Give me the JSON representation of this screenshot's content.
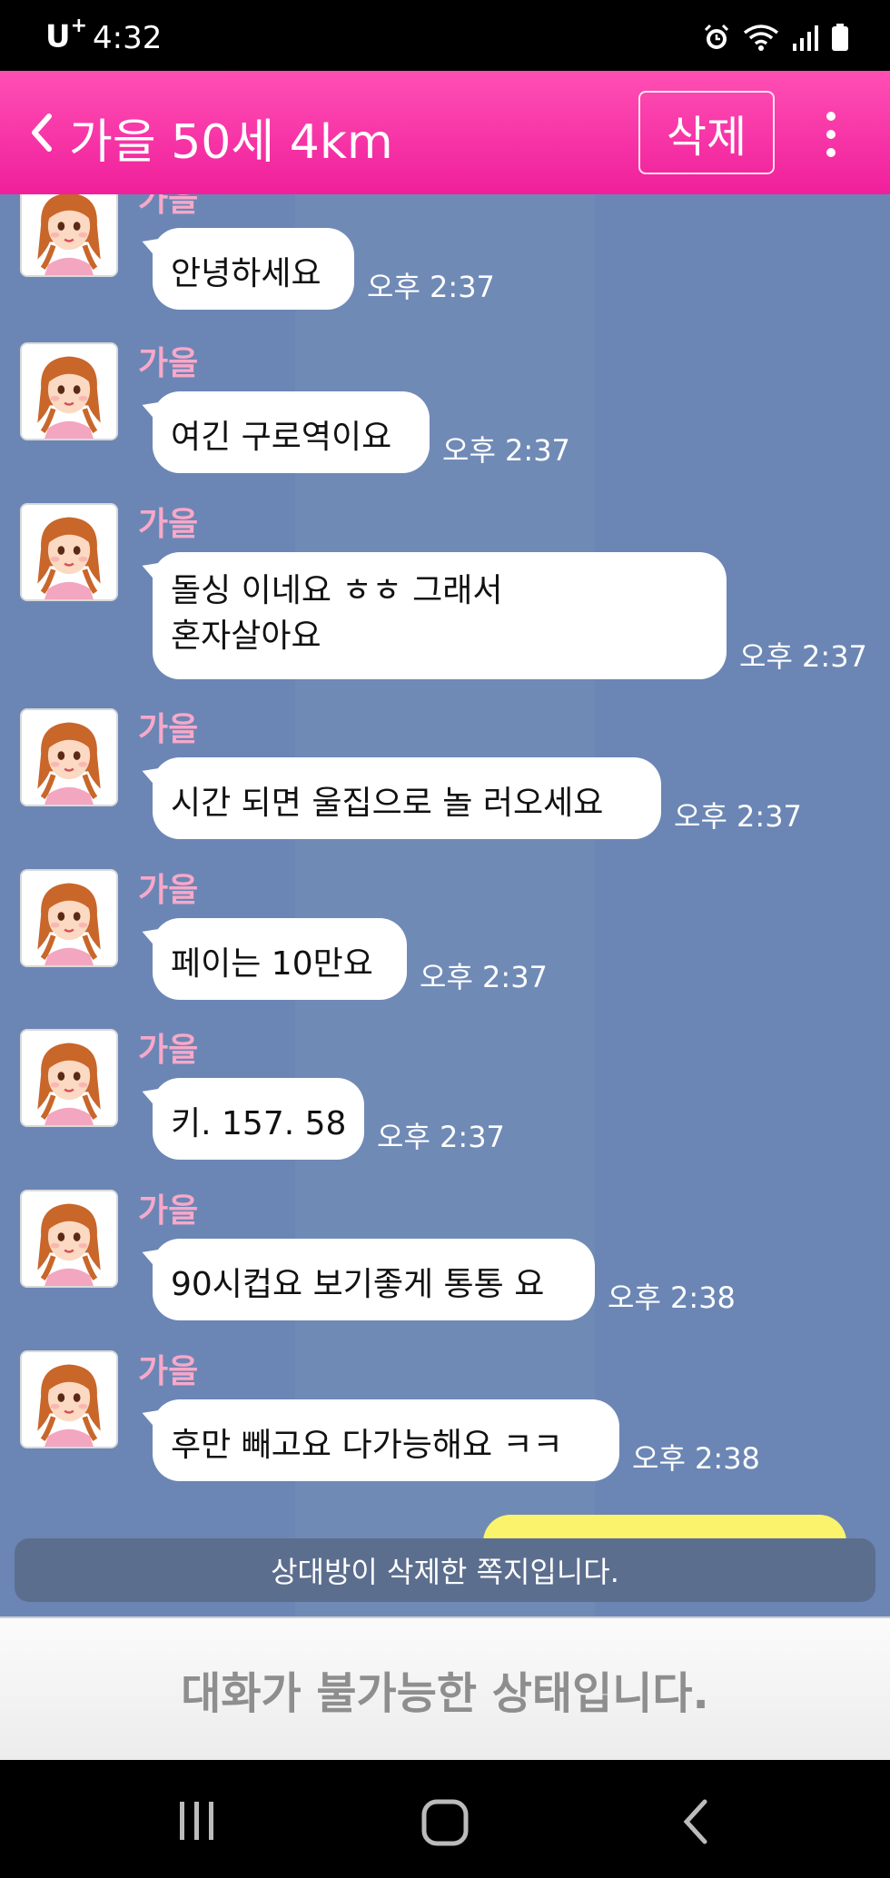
{
  "status_bar": {
    "carrier": "U",
    "carrier_sup": "+",
    "time": "4:32",
    "icons": [
      "alarm-icon",
      "wifi-icon",
      "signal-icon",
      "battery-icon"
    ]
  },
  "header": {
    "title": "가을 50세 4km",
    "delete_label": "삭제",
    "back_icon": "chevron-left-icon",
    "more_icon": "more-vertical-icon"
  },
  "messages": [
    {
      "sender": "가을",
      "text": "안녕하세요",
      "time": "오후 2:37"
    },
    {
      "sender": "가을",
      "text": "여긴 구로역이요",
      "time": "오후 2:37"
    },
    {
      "sender": "가을",
      "text": "돌싱 이네요 ㅎㅎ 그래서\n혼자살아요",
      "time": "오후 2:37"
    },
    {
      "sender": "가을",
      "text": "시간 되면 울집으로 놀 러오세요",
      "time": "오후 2:37"
    },
    {
      "sender": "가을",
      "text": "페이는 10만요",
      "time": "오후 2:37"
    },
    {
      "sender": "가을",
      "text": "키. 157. 58",
      "time": "오후 2:37"
    },
    {
      "sender": "가을",
      "text": "90시컵요 보기좋게 통통 요",
      "time": "오후 2:38"
    },
    {
      "sender": "가을",
      "text": "후만 빼고요 다가능해요 ㅋㅋ",
      "time": "오후 2:38"
    }
  ],
  "deleted_notice": "상대방이 삭제한 쪽지입니다.",
  "footer_status": "대화가 불가능한 상태입니다.",
  "colors": {
    "header": "#f01f9b",
    "chat_background": "#6b86b4",
    "sender_name": "#f7a8c9",
    "bubble": "#ffffff",
    "my_bubble": "#fbf36b"
  }
}
